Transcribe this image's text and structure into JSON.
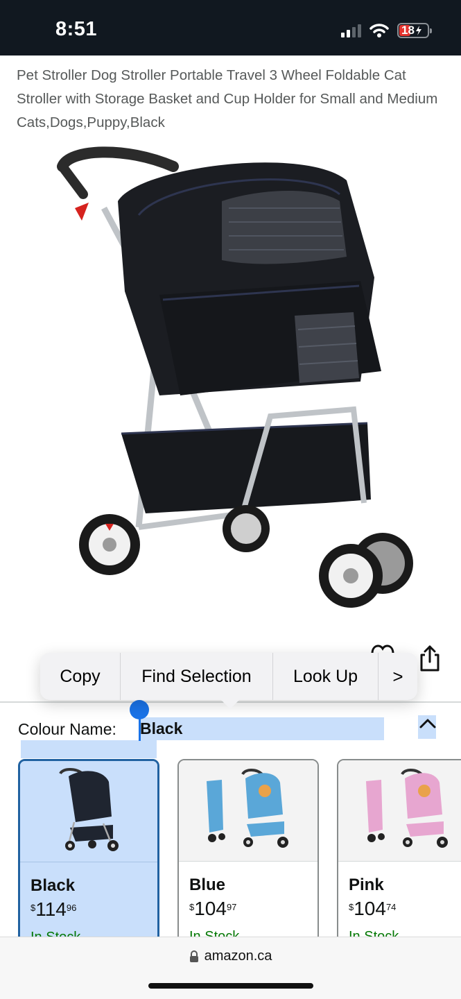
{
  "status_bar": {
    "time": "8:51",
    "battery": "18",
    "signal_icon": "cellular-signal-icon",
    "wifi_icon": "wifi-icon",
    "battery_icon": "battery-charging-icon"
  },
  "product": {
    "title": "Pet Stroller Dog Stroller Portable Travel 3 Wheel Foldable Cat Stroller with Storage Basket and Cup Holder for Small and Medium Cats,Dogs,Puppy,Black",
    "image_icon": "pet-stroller-image"
  },
  "context_menu": {
    "items": [
      "Copy",
      "Find Selection",
      "Look Up",
      ">"
    ]
  },
  "colour": {
    "label": "Colour Name:",
    "value": "Black"
  },
  "swatches": [
    {
      "name": "Black",
      "currency": "$",
      "price_whole": "114",
      "price_fraction": "96",
      "stock": "In Stock",
      "selected": true,
      "color": "#1f2530"
    },
    {
      "name": "Blue",
      "currency": "$",
      "price_whole": "104",
      "price_fraction": "97",
      "stock": "In Stock",
      "selected": false,
      "color": "#5aa7d8"
    },
    {
      "name": "Pink",
      "currency": "$",
      "price_whole": "104",
      "price_fraction": "74",
      "stock": "In Stock",
      "selected": false,
      "color": "#e7a6d0"
    }
  ],
  "browser": {
    "url": "amazon.ca"
  },
  "colors": {
    "status_bar_bg": "#111820",
    "selection": "#c9dffb",
    "selected_border": "#2162a1",
    "handle_blue": "#1a73e8",
    "in_stock": "#007600"
  }
}
